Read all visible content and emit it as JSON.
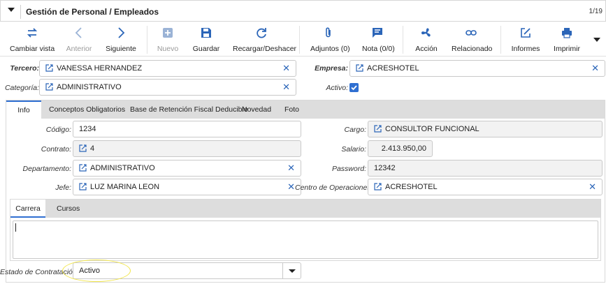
{
  "window": {
    "title": "Gestión de Personal / Empleados",
    "record_count": "1/19"
  },
  "toolbar": {
    "items": [
      {
        "label": "Cambiar vista",
        "icon": "swap-arrows-icon",
        "enabled": true
      },
      {
        "label": "Anterior",
        "icon": "chevron-left-icon",
        "enabled": false
      },
      {
        "label": "Siguiente",
        "icon": "chevron-right-icon",
        "enabled": true
      },
      {
        "label": "Nuevo",
        "icon": "plus-square-icon",
        "enabled": false
      },
      {
        "label": "Guardar",
        "icon": "save-icon",
        "enabled": true
      },
      {
        "label": "Recargar/Deshacer",
        "icon": "reload-icon",
        "enabled": true
      },
      {
        "label": "Adjuntos (0)",
        "icon": "paperclip-icon",
        "enabled": true
      },
      {
        "label": "Nota (0/0)",
        "icon": "note-icon",
        "enabled": true
      },
      {
        "label": "Acción",
        "icon": "fan-icon",
        "enabled": true
      },
      {
        "label": "Relacionado",
        "icon": "link-icon",
        "enabled": true
      },
      {
        "label": "Informes",
        "icon": "edit-box-icon",
        "enabled": true
      },
      {
        "label": "Imprimir",
        "icon": "printer-icon",
        "enabled": true
      }
    ],
    "more_icon": "caret-down-icon"
  },
  "header_fields": {
    "tercero": {
      "label": "Tercero:",
      "value": "VANESSA HERNANDEZ"
    },
    "empresa": {
      "label": "Empresa:",
      "value": "ACRESHOTEL"
    },
    "categoria": {
      "label": "Categoría:",
      "value": "ADMINISTRATIVO"
    },
    "activo": {
      "label": "Activo:",
      "checked": true
    }
  },
  "tabs": [
    {
      "label": "Info",
      "active": true
    },
    {
      "label": "Conceptos Obligatorios",
      "active": false
    },
    {
      "label": "Base de Retención Fiscal Deducible",
      "active": false
    },
    {
      "label": "Novedad",
      "active": false
    },
    {
      "label": "Foto",
      "active": false
    }
  ],
  "info": {
    "codigo": {
      "label": "Código:",
      "value": "1234"
    },
    "contrato": {
      "label": "Contrato:",
      "value": "4"
    },
    "departamento": {
      "label": "Departamento:",
      "value": "ADMINISTRATIVO"
    },
    "jefe": {
      "label": "Jefe:",
      "value": "LUZ MARINA LEON"
    },
    "cargo": {
      "label": "Cargo:",
      "value": "CONSULTOR FUNCIONAL"
    },
    "salario": {
      "label": "Salario:",
      "value": "2.413.950,00"
    },
    "password": {
      "label": "Password:",
      "value": "12342"
    },
    "centro": {
      "label": "Centro de Operaciones:",
      "value": "ACRESHOTEL"
    }
  },
  "subtabs": [
    {
      "label": "Carrera",
      "active": true
    },
    {
      "label": "Cursos",
      "active": false
    }
  ],
  "estado": {
    "label": "Estado de Contratación:",
    "value": "Activo"
  },
  "colors": {
    "accent": "#2f6fd1",
    "highlight": "#f2e64a",
    "tab_bar": "#dddddd"
  }
}
